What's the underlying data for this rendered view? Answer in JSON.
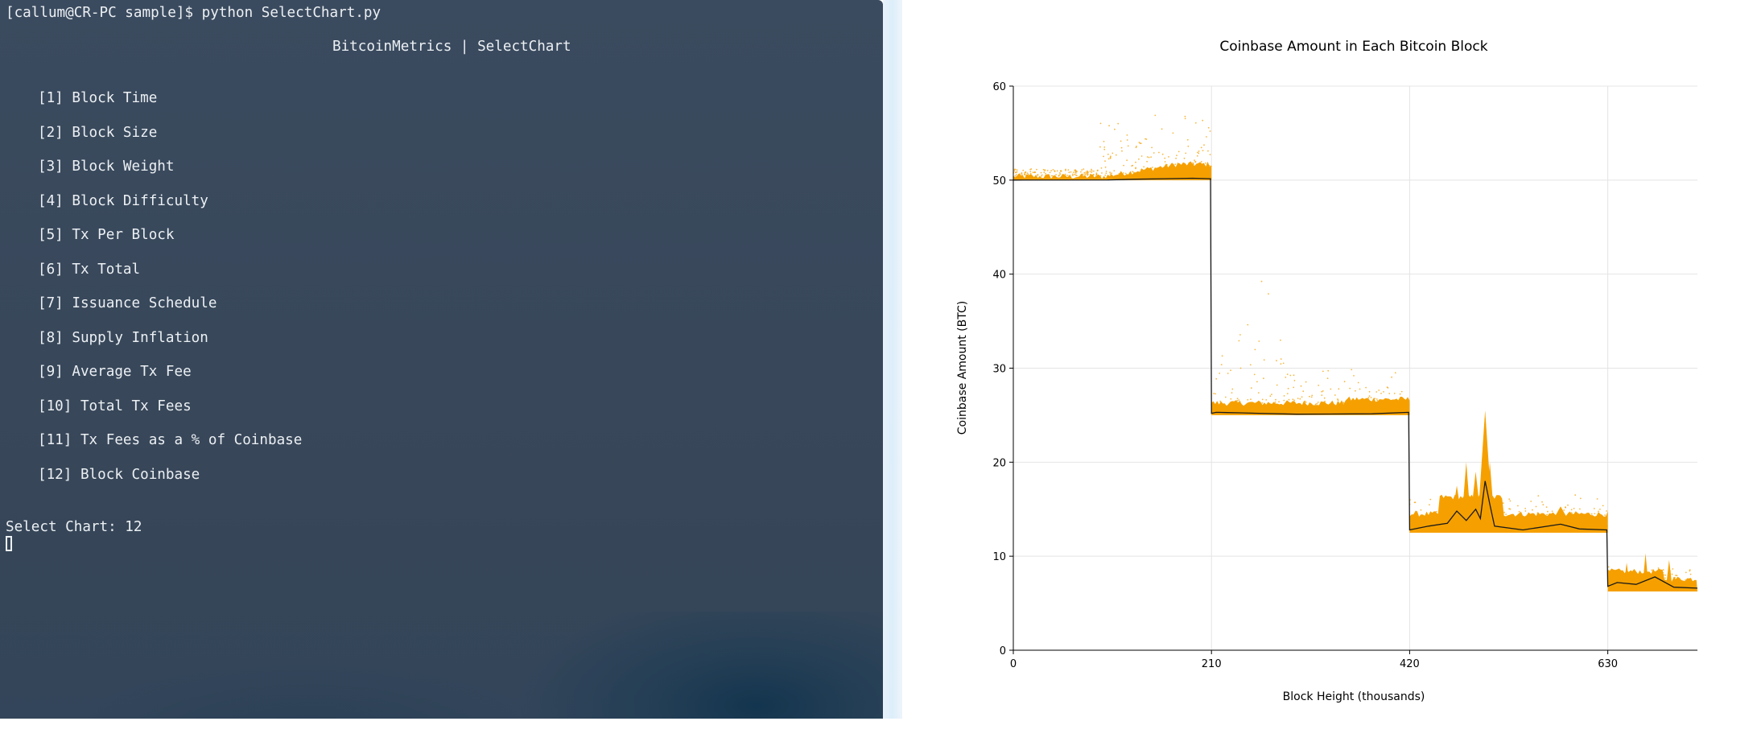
{
  "terminal": {
    "prompt": "[callum@CR-PC sample]$ python SelectChart.py",
    "header": "BitcoinMetrics | SelectChart",
    "menu_items": [
      "[1] Block Time",
      "[2] Block Size",
      "[3] Block Weight",
      "[4] Block Difficulty",
      "[5] Tx Per Block",
      "[6] Tx Total",
      "[7] Issuance Schedule",
      "[8] Supply Inflation",
      "[9] Average Tx Fee",
      "[10] Total Tx Fees",
      "[11] Tx Fees as a % of Coinbase",
      "[12] Block Coinbase"
    ],
    "input_line": "Select Chart: 12",
    "colors": {
      "text": "#ecf0f4",
      "background": "#3b4b5f"
    }
  },
  "chart_data": {
    "type": "scatter",
    "title": "Coinbase Amount in Each Bitcoin Block",
    "xlabel": "Block Height (thousands)",
    "ylabel": "Coinbase Amount (BTC)",
    "xlim": [
      0,
      725
    ],
    "ylim": [
      0,
      60
    ],
    "xticks": [
      0,
      210,
      420,
      630
    ],
    "yticks": [
      0,
      10,
      20,
      30,
      40,
      50,
      60
    ],
    "grid": true,
    "colors": {
      "scatter": "#f5a000",
      "line": "#1a1a1a"
    },
    "series": [
      {
        "values": [
          [
            0,
            50.0
          ],
          [
            100,
            50.02
          ],
          [
            130,
            50.1
          ],
          [
            160,
            50.15
          ],
          [
            190,
            50.2
          ],
          [
            209,
            50.15
          ],
          [
            210,
            25.2
          ],
          [
            215,
            25.3
          ],
          [
            240,
            25.25
          ],
          [
            260,
            25.2
          ],
          [
            300,
            25.1
          ],
          [
            380,
            25.15
          ],
          [
            419,
            25.3
          ],
          [
            420,
            12.8
          ],
          [
            440,
            13.2
          ],
          [
            460,
            13.5
          ],
          [
            470,
            14.8
          ],
          [
            480,
            13.8
          ],
          [
            490,
            15.0
          ],
          [
            495,
            14.0
          ],
          [
            500,
            18.0
          ],
          [
            505,
            15.5
          ],
          [
            510,
            13.2
          ],
          [
            540,
            12.8
          ],
          [
            580,
            13.4
          ],
          [
            600,
            12.9
          ],
          [
            629,
            12.8
          ],
          [
            630,
            6.8
          ],
          [
            640,
            7.2
          ],
          [
            660,
            7.0
          ],
          [
            680,
            7.8
          ],
          [
            700,
            6.7
          ],
          [
            725,
            6.6
          ]
        ]
      }
    ]
  }
}
